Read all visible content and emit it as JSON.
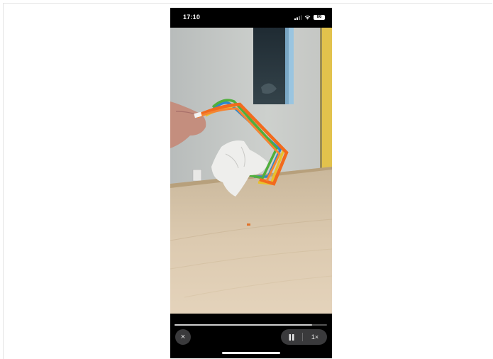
{
  "status_bar": {
    "time": "17:10",
    "battery": "86",
    "icons": [
      "signal-icon",
      "wifi-icon",
      "battery-icon"
    ]
  },
  "video": {
    "content": "video-frame",
    "progress": 0.9
  },
  "controls": {
    "close_icon": "×",
    "speed_label": "1×",
    "pause_icon": "pause-icon"
  },
  "colors": {
    "background": "#000000",
    "control_fill": "#3a3a3c",
    "control_text": "#e8e8e8",
    "scrubber_fill": "#cfcfcf"
  }
}
